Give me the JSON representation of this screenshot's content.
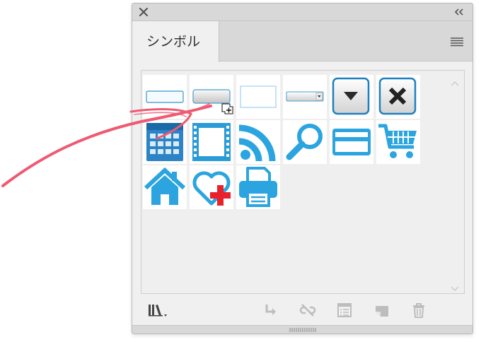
{
  "panel": {
    "tab_label": "シンボル"
  },
  "icons": {
    "close": "close-icon",
    "collapse": "double-chevron-left-icon",
    "panel_menu": "hamburger-menu-icon",
    "library_menu": "symbol-library-menu-icon",
    "place_instance": "place-symbol-instance-icon",
    "break_link": "break-link-icon",
    "symbol_options": "symbol-options-icon",
    "new_symbol": "new-symbol-icon",
    "delete": "trash-icon",
    "scroll_up": "chevron-up-icon",
    "scroll_down": "chevron-down-icon",
    "drop_cursor": "drag-add-cursor-icon"
  },
  "symbols": [
    "button-flat-symbol",
    "button-gradient-symbol",
    "text-field-symbol",
    "dropdown-select-symbol",
    "dropdown-arrow-button-symbol",
    "close-x-button-symbol",
    "calendar-symbol",
    "film-strip-symbol",
    "rss-feed-symbol",
    "magnifier-symbol",
    "credit-card-symbol",
    "shopping-cart-symbol",
    "home-symbol",
    "heart-plus-symbol",
    "printer-symbol"
  ],
  "colors": {
    "accent_blue": "#29a3de",
    "arrow_red": "#ee5a72",
    "panel_bg": "#f0f0f0",
    "titlebar_bg": "#d8d8d8"
  }
}
